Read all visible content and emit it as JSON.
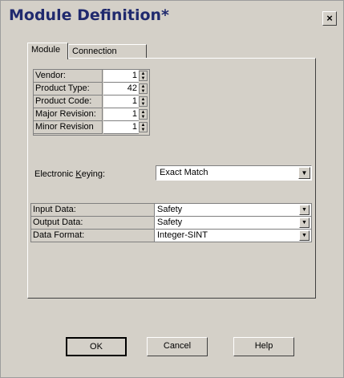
{
  "window": {
    "title": "Module Definition*",
    "close_glyph": "×"
  },
  "tabs": [
    {
      "label": "Module",
      "active": true
    },
    {
      "label": "Connection",
      "active": false
    }
  ],
  "module_info": [
    {
      "label": "Vendor:",
      "value": "1"
    },
    {
      "label": "Product Type:",
      "value": "42"
    },
    {
      "label": "Product Code:",
      "value": "1"
    },
    {
      "label": "Major Revision:",
      "value": "1"
    },
    {
      "label": "Minor Revision",
      "value": "1"
    }
  ],
  "keying": {
    "label_prefix": "Electronic ",
    "label_accel": "K",
    "label_suffix": "eying:",
    "value": "Exact Match"
  },
  "data_settings": [
    {
      "label": "Input Data:",
      "value": "Safety"
    },
    {
      "label": "Output Data:",
      "value": "Safety"
    },
    {
      "label": "Data Format:",
      "value": "Integer-SINT"
    }
  ],
  "buttons": {
    "ok": "OK",
    "cancel": "Cancel",
    "help": "Help"
  }
}
